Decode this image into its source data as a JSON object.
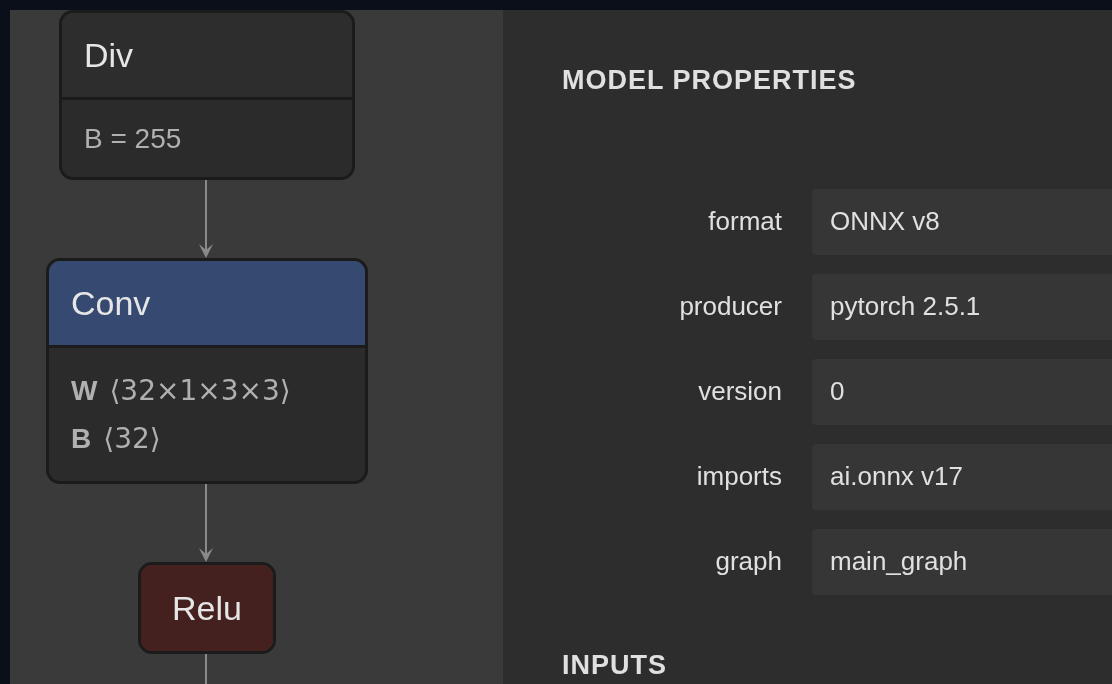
{
  "graph": {
    "nodes": [
      {
        "title": "Div",
        "color": "#2d2d2d",
        "attributes": [
          {
            "kind": "assignment",
            "text": "B = 255"
          }
        ]
      },
      {
        "title": "Conv",
        "color": "#364a71",
        "attributes": [
          {
            "kind": "tensor",
            "name": "W",
            "shape": "⟨32×1×3×3⟩"
          },
          {
            "kind": "tensor",
            "name": "B",
            "shape": "⟨32⟩"
          }
        ]
      },
      {
        "title": "Relu",
        "color": "#44201f"
      }
    ]
  },
  "model_properties": {
    "title": "MODEL PROPERTIES",
    "rows": [
      {
        "label": "format",
        "value": "ONNX v8"
      },
      {
        "label": "producer",
        "value": "pytorch 2.5.1"
      },
      {
        "label": "version",
        "value": "0"
      },
      {
        "label": "imports",
        "value": "ai.onnx v17"
      },
      {
        "label": "graph",
        "value": "main_graph"
      }
    ]
  },
  "inputs": {
    "title": "INPUTS"
  }
}
